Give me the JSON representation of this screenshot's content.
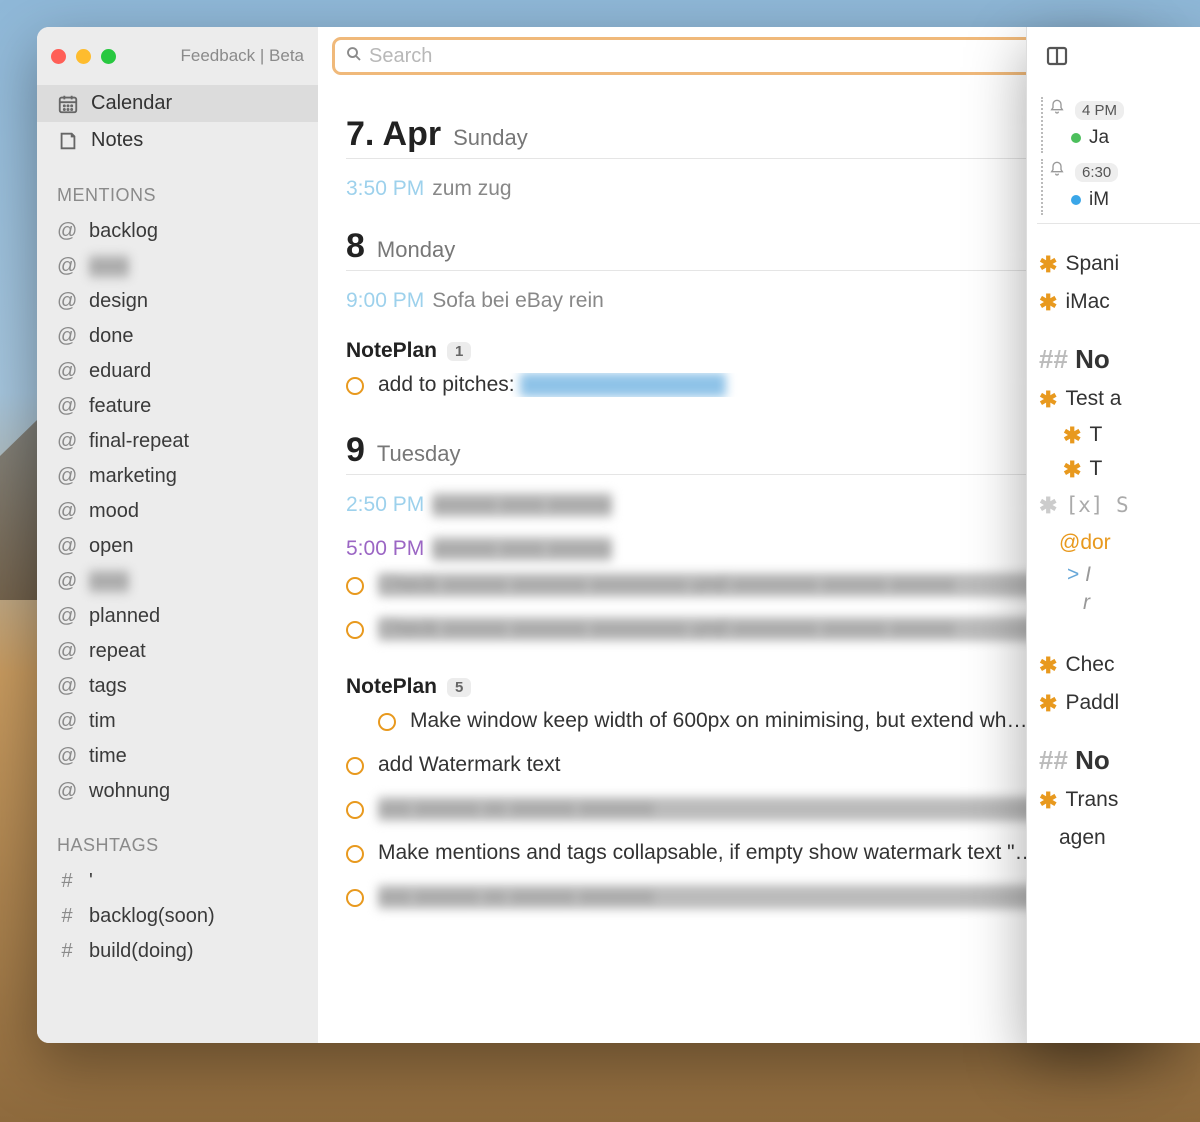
{
  "titlebar": {
    "feedback": "Feedback | Beta"
  },
  "search": {
    "placeholder": "Search"
  },
  "nav": {
    "calendar": "Calendar",
    "notes": "Notes"
  },
  "sections": {
    "mentions": "MENTIONS",
    "hashtags": "HASHTAGS"
  },
  "mentions": [
    "backlog",
    "■■■",
    "design",
    "done",
    "eduard",
    "feature",
    "final-repeat",
    "marketing",
    "mood",
    "open",
    "■■■■■",
    "planned",
    "repeat",
    "tags",
    "tim",
    "time",
    "wohnung"
  ],
  "hashtags": [
    "'",
    "backlog(soon)",
    "build(doing)"
  ],
  "days": [
    {
      "num": "7.",
      "month": "Apr",
      "name": "Sunday",
      "events": [
        {
          "time": "3:50 PM",
          "text": "zum zug",
          "color": "blue"
        }
      ],
      "tasks": []
    },
    {
      "num": "8",
      "month": "",
      "name": "Monday",
      "events": [
        {
          "time": "9:00 PM",
          "text": "Sofa bei eBay rein",
          "color": "blue"
        }
      ],
      "groups": [
        {
          "title": "NotePlan",
          "count": "1",
          "tasks": [
            {
              "text": "add to pitches: ",
              "blurred_suffix": "https://basecomp.tech",
              "indent": false
            }
          ]
        }
      ]
    },
    {
      "num": "9",
      "month": "",
      "name": "Tuesday",
      "events": [
        {
          "time": "2:50 PM",
          "text": "■■■",
          "color": "blue"
        },
        {
          "time": "5:00 PM",
          "text": "■■■■■ ■■■■ ■■■■■■",
          "color": "purple"
        }
      ],
      "loose_tasks": [
        {
          "blurred": "Check Purpose Calendar Dokumente und definiere eigene Vision"
        },
        {
          "blurred": "Check wie man am besten eine Wohnung findet wo Tobi wohnt link"
        }
      ],
      "groups": [
        {
          "title": "NotePlan",
          "count": "5",
          "tasks": [
            {
              "text": "Make window keep width of 600px on minimising, but extend wh…",
              "indent": true
            },
            {
              "text": "add Watermark text"
            },
            {
              "blurred": "Wie machen wir Paddle upgrade?"
            },
            {
              "text": "Make mentions and tags collapsable, if empty show watermark text \"…"
            },
            {
              "blurred": "Launch the updates. Bigger webseiten sehen through HMAC ev"
            }
          ]
        }
      ]
    }
  ],
  "right": {
    "reminders": [
      {
        "time": "4 PM",
        "dot": "green",
        "label": "Ja"
      },
      {
        "time": "6:30",
        "dot": "blue",
        "label": "iM"
      }
    ],
    "bullets1": [
      "Spani",
      "iMac"
    ],
    "heading1": "No",
    "bullets2": [
      {
        "text": "Test a",
        "subs": [
          "T",
          "T"
        ]
      }
    ],
    "done_line": "[x]  S",
    "mention": "@dor",
    "quote1": "> I",
    "quote2": "r",
    "bullets3": [
      "Chec",
      "Paddl"
    ],
    "heading2": "No",
    "bullets4": [
      {
        "text": "Trans",
        "cont": "agen"
      }
    ]
  }
}
